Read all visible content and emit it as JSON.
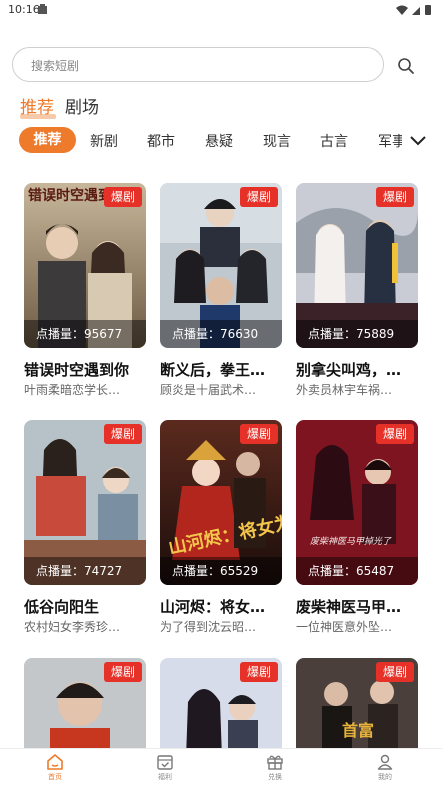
{
  "status_bar": {
    "time": "10:16"
  },
  "search": {
    "placeholder": "搜索短剧"
  },
  "top_tabs": [
    {
      "label": "推荐",
      "active": true
    },
    {
      "label": "剧场",
      "active": false
    }
  ],
  "categories": [
    "推荐",
    "新剧",
    "都市",
    "悬疑",
    "现言",
    "古言",
    "军事"
  ],
  "dramas": [
    {
      "title": "错误时空遇到你",
      "desc": "叶雨柔暗恋学长…",
      "badge": "爆剧",
      "views": "点播量：95677"
    },
    {
      "title": "断义后，拳王…",
      "desc": "顾炎是十届武术…",
      "badge": "爆剧",
      "views": "点播量：76630"
    },
    {
      "title": "别拿尖叫鸡，…",
      "desc": "外卖员林宇车祸…",
      "badge": "爆剧",
      "views": "点播量：75889"
    },
    {
      "title": "低谷向阳生",
      "desc": "农村妇女李秀珍…",
      "badge": "爆剧",
      "views": "点播量：74727"
    },
    {
      "title": "山河烬：将女…",
      "desc": "为了得到沈云昭…",
      "badge": "爆剧",
      "views": "点播量：65529"
    },
    {
      "title": "废柴神医马甲…",
      "desc": "一位神医意外坠…",
      "badge": "爆剧",
      "views": "点播量：65487"
    },
    {
      "title": "",
      "desc": "",
      "badge": "爆剧",
      "views": ""
    },
    {
      "title": "",
      "desc": "",
      "badge": "爆剧",
      "views": ""
    },
    {
      "title": "",
      "desc": "",
      "badge": "爆剧",
      "views": ""
    }
  ],
  "poster_texts": {
    "p1": "错误时空遇到你",
    "p5": "山河烬：将女为凰",
    "p6": "废柴神医马甲掉光了",
    "p9": "首富"
  },
  "bottom_nav": [
    {
      "label": "首页",
      "icon": "home-icon",
      "active": true
    },
    {
      "label": "福利",
      "icon": "calendar-check-icon",
      "active": false
    },
    {
      "label": "兑换",
      "icon": "gift-icon",
      "active": false
    },
    {
      "label": "我的",
      "icon": "user-icon",
      "active": false
    }
  ],
  "colors": {
    "accent": "#ee7a2c",
    "badge": "#e53127"
  }
}
